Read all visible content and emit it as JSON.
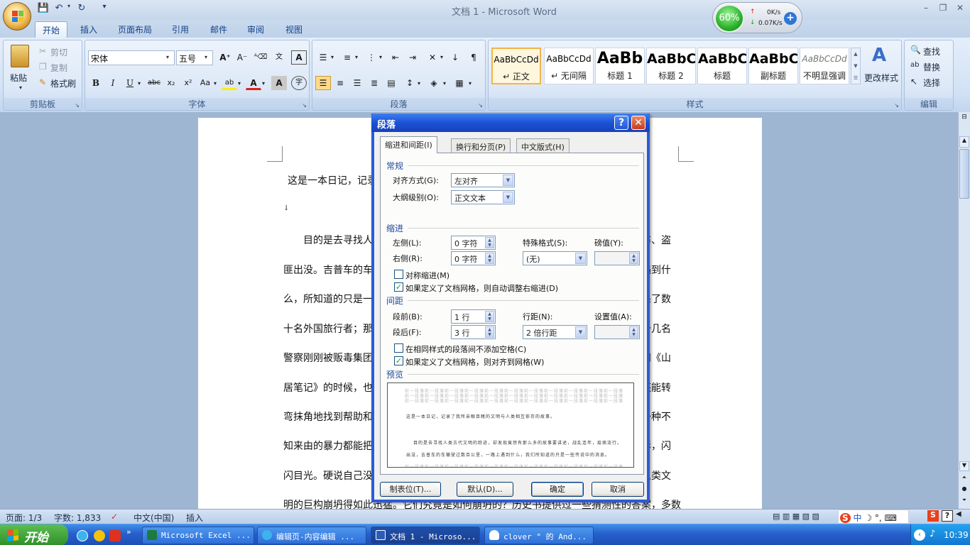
{
  "window": {
    "title": "文档 1 - Microsoft Word"
  },
  "net": {
    "percent": "60%",
    "up": "0K/s",
    "down": "0.07K/s"
  },
  "tabs": [
    "开始",
    "插入",
    "页面布局",
    "引用",
    "邮件",
    "审阅",
    "视图"
  ],
  "clipboard": {
    "paste": "粘贴",
    "cut": "剪切",
    "copy": "复制",
    "format": "格式刷",
    "group": "剪贴板"
  },
  "font": {
    "name": "宋体",
    "size": "五号",
    "group": "字体"
  },
  "paragraph": {
    "group": "段落"
  },
  "styles": {
    "group": "样式",
    "change": "更改样式",
    "items": [
      {
        "preview": "AaBbCcDd",
        "name": "↵ 正文"
      },
      {
        "preview": "AaBbCcDd",
        "name": "↵ 无间隔"
      },
      {
        "preview": "AaBb",
        "name": "标题 1"
      },
      {
        "preview": "AaBbC",
        "name": "标题 2"
      },
      {
        "preview": "AaBbC",
        "name": "标题"
      },
      {
        "preview": "AaBbC",
        "name": "副标题"
      },
      {
        "preview": "AaBbCcDd",
        "name": "不明显强调"
      }
    ]
  },
  "editing": {
    "group": "编辑",
    "find": "查找",
    "replace": "替换",
    "select": "选择"
  },
  "doc": {
    "lines": [
      {
        "left": "这是一本日记，记录",
        "right": ""
      },
      {
        "left": "↓",
        "right": ""
      },
      {
        "left": "目的是去寻找人",
        "right": "布、盗"
      },
      {
        "left": "匪出没。吉普车的车",
        "right": "遇到什"
      },
      {
        "left": "么，所知道的只是一",
        "right": "杀了数"
      },
      {
        "left": "十名外国旅行者；那",
        "right": "十几名"
      },
      {
        "left": "警察刚刚被贩毒集团",
        "right": "和《山"
      },
      {
        "left": "居笔记》的时候，也",
        "right": "还能转"
      },
      {
        "left": "弯抹角地找到帮助和",
        "right": "一种不"
      },
      {
        "left": "知来由的暴力都能把",
        "right": "影，闪"
      },
      {
        "left": "闪目光。硬说自己没",
        "right": "人类文"
      },
      {
        "left": "明的巨构崩坍得如此迅猛。它们究竟是如何崩坍的？历史书提供过一些猜测性的答案，多数",
        "right": ""
      }
    ]
  },
  "status": {
    "page": "页面: 1/3",
    "words": "字数: 1,833",
    "lang": "中文(中国)",
    "mode": "插入"
  },
  "dialog": {
    "title": "段落",
    "tabs": [
      "缩进和间距(I)",
      "换行和分页(P)",
      "中文版式(H)"
    ],
    "general": {
      "label": "常规",
      "align_label": "对齐方式(G):",
      "align": "左对齐",
      "outline_label": "大纲级别(O):",
      "outline": "正文文本"
    },
    "indent": {
      "label": "缩进",
      "left_label": "左侧(L):",
      "left": "0 字符",
      "right_label": "右侧(R):",
      "right": "0 字符",
      "special_label": "特殊格式(S):",
      "special": "(无)",
      "by_label": "磅值(Y):",
      "by": "",
      "mirror": "对称缩进(M)",
      "auto": "如果定义了文档网格，则自动调整右缩进(D)",
      "mirror_checked": false,
      "auto_checked": true
    },
    "spacing": {
      "label": "间距",
      "before_label": "段前(B):",
      "before": "1 行",
      "after_label": "段后(F):",
      "after": "3 行",
      "line_label": "行距(N):",
      "line": "2 倍行距",
      "at_label": "设置值(A):",
      "at": "",
      "nospace": "在相同样式的段落间不添加空格(C)",
      "snap": "如果定义了文档网格，则对齐到网格(W)",
      "nospace_checked": false,
      "snap_checked": true
    },
    "preview": {
      "label": "预览",
      "sample1": "这是一本日记，记录了我所亲眼目睹的文明与人类相互依存的故事。",
      "sample2": "目的是去寻找人类古代文明的踪迹，却发现竟然有那么多的故事要讲述，战乱连年，疫病流行。",
      "sample3": "出没，吉普车的车辙驶过数百公里，一路上遇到什么，我们所知道的只是一些传说中的消息。",
      "prev": "前一段落前一段落前一段落前一段落前一段落前一段落前一段落前一段落前一段落前一段落前一段落"
    },
    "buttons": {
      "tabs": "制表位(T)...",
      "default": "默认(D)...",
      "ok": "确定",
      "cancel": "取消"
    }
  },
  "taskbar": {
    "start": "开始",
    "tasks": [
      "Microsoft Excel ...",
      "编辑页-内容编辑 ...",
      "文档 1 - Microso...",
      "clover ° 的 And..."
    ],
    "time": "10:39"
  }
}
